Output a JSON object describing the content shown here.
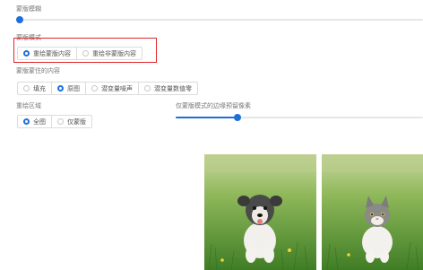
{
  "mask_blur": {
    "label": "蒙版模糊",
    "value_fraction": 0.0
  },
  "mask_mode": {
    "label": "蒙版模式",
    "options": [
      {
        "label": "重绘蒙版内容",
        "checked": true
      },
      {
        "label": "重绘非蒙版内容",
        "checked": false
      }
    ]
  },
  "masked_content": {
    "label": "蒙版蒙住的内容",
    "options": [
      {
        "label": "填充",
        "checked": false
      },
      {
        "label": "原图",
        "checked": true
      },
      {
        "label": "潜变量噪声",
        "checked": false
      },
      {
        "label": "潜变量数值零",
        "checked": false
      }
    ]
  },
  "inpaint_area": {
    "label": "重绘区域",
    "options": [
      {
        "label": "全图",
        "checked": true
      },
      {
        "label": "仅蒙版",
        "checked": false
      }
    ]
  },
  "only_masked_padding": {
    "label": "仅蒙版模式的边缘预留像素",
    "value_fraction": 0.25
  },
  "colors": {
    "accent": "#1e6fd9",
    "highlight": "#e0262b"
  },
  "images": [
    {
      "subject": "puppy-in-grass"
    },
    {
      "subject": "kitten-in-grass"
    }
  ]
}
